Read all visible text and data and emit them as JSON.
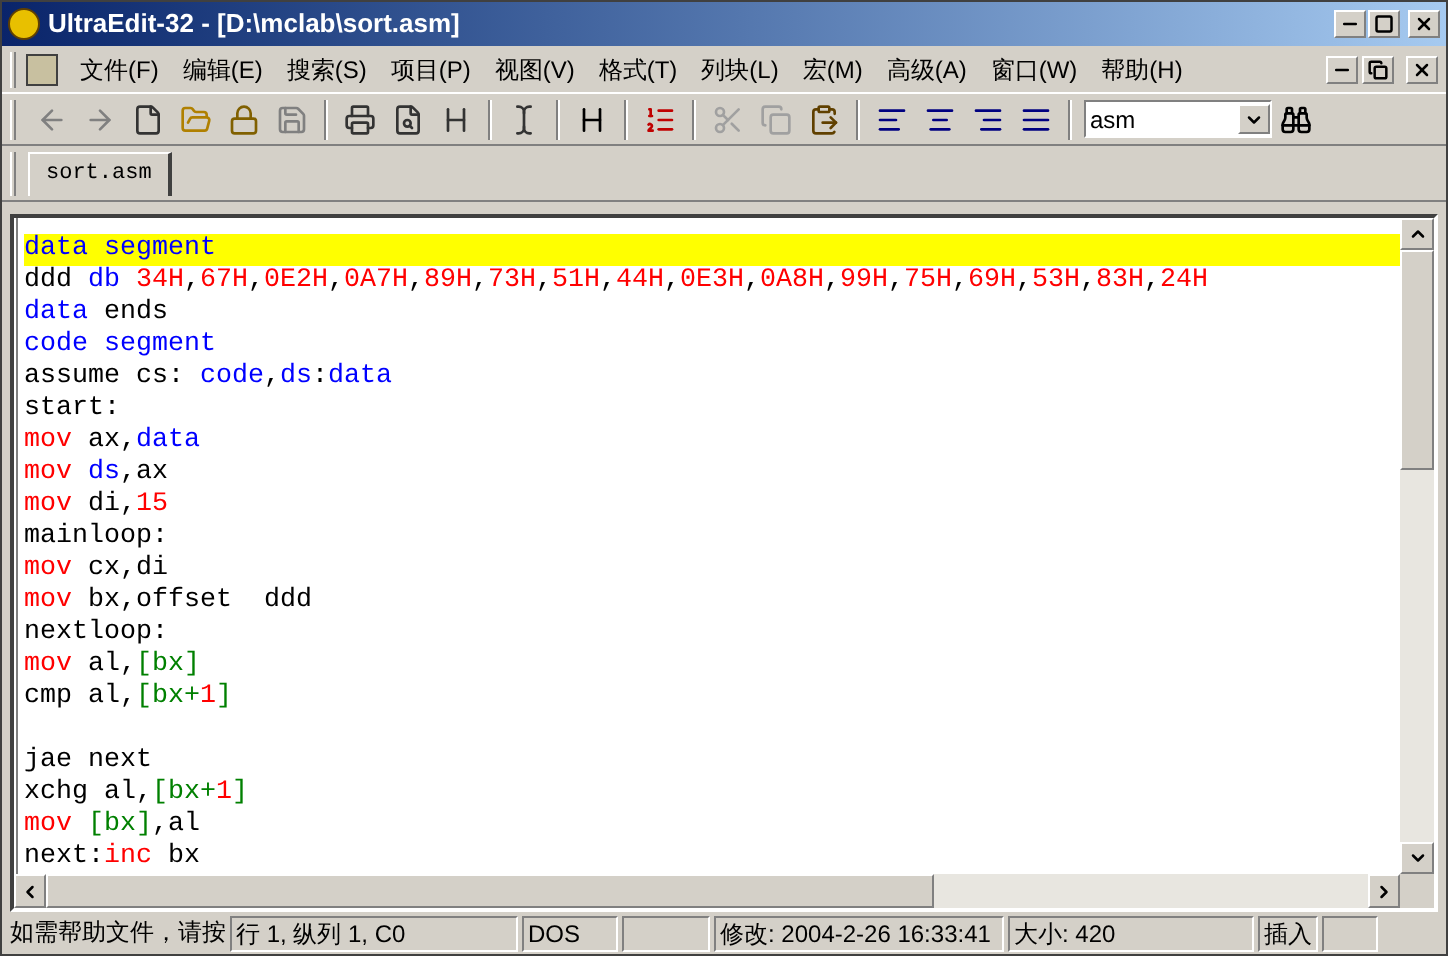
{
  "window": {
    "title": "UltraEdit-32 - [D:\\mclab\\sort.asm]"
  },
  "menu": [
    "文件(F)",
    "编辑(E)",
    "搜索(S)",
    "项目(P)",
    "视图(V)",
    "格式(T)",
    "列块(L)",
    "宏(M)",
    "高级(A)",
    "窗口(W)",
    "帮助(H)"
  ],
  "toolbar": {
    "syntax_select": {
      "value": "asm"
    }
  },
  "tabs": [
    {
      "label": "sort.asm",
      "selected": true
    }
  ],
  "editor": {
    "lines": [
      {
        "highlighted": true,
        "tokens": [
          {
            "kind": "keyword",
            "text": "data segment"
          }
        ]
      },
      {
        "highlighted": false,
        "tokens": [
          {
            "kind": "plain",
            "text": "ddd "
          },
          {
            "kind": "keyword",
            "text": "db "
          },
          {
            "kind": "number",
            "text": "34H"
          },
          {
            "kind": "plain",
            "text": ","
          },
          {
            "kind": "number",
            "text": "67H"
          },
          {
            "kind": "plain",
            "text": ","
          },
          {
            "kind": "number",
            "text": "0E2H"
          },
          {
            "kind": "plain",
            "text": ","
          },
          {
            "kind": "number",
            "text": "0A7H"
          },
          {
            "kind": "plain",
            "text": ","
          },
          {
            "kind": "number",
            "text": "89H"
          },
          {
            "kind": "plain",
            "text": ","
          },
          {
            "kind": "number",
            "text": "73H"
          },
          {
            "kind": "plain",
            "text": ","
          },
          {
            "kind": "number",
            "text": "51H"
          },
          {
            "kind": "plain",
            "text": ","
          },
          {
            "kind": "number",
            "text": "44H"
          },
          {
            "kind": "plain",
            "text": ","
          },
          {
            "kind": "number",
            "text": "0E3H"
          },
          {
            "kind": "plain",
            "text": ","
          },
          {
            "kind": "number",
            "text": "0A8H"
          },
          {
            "kind": "plain",
            "text": ","
          },
          {
            "kind": "number",
            "text": "99H"
          },
          {
            "kind": "plain",
            "text": ","
          },
          {
            "kind": "number",
            "text": "75H"
          },
          {
            "kind": "plain",
            "text": ","
          },
          {
            "kind": "number",
            "text": "69H"
          },
          {
            "kind": "plain",
            "text": ","
          },
          {
            "kind": "number",
            "text": "53H"
          },
          {
            "kind": "plain",
            "text": ","
          },
          {
            "kind": "number",
            "text": "83H"
          },
          {
            "kind": "plain",
            "text": ","
          },
          {
            "kind": "number",
            "text": "24H"
          }
        ]
      },
      {
        "highlighted": false,
        "tokens": [
          {
            "kind": "keyword",
            "text": "data"
          },
          {
            "kind": "plain",
            "text": " ends"
          }
        ]
      },
      {
        "highlighted": false,
        "tokens": [
          {
            "kind": "keyword",
            "text": "code segment"
          }
        ]
      },
      {
        "highlighted": false,
        "tokens": [
          {
            "kind": "plain",
            "text": "assume cs: "
          },
          {
            "kind": "keyword",
            "text": "code"
          },
          {
            "kind": "plain",
            "text": ","
          },
          {
            "kind": "keyword",
            "text": "ds"
          },
          {
            "kind": "plain",
            "text": ":"
          },
          {
            "kind": "keyword",
            "text": "data"
          }
        ]
      },
      {
        "highlighted": false,
        "tokens": [
          {
            "kind": "plain",
            "text": "start:"
          }
        ]
      },
      {
        "highlighted": false,
        "tokens": [
          {
            "kind": "number",
            "text": "mov"
          },
          {
            "kind": "plain",
            "text": " ax,"
          },
          {
            "kind": "keyword",
            "text": "data"
          }
        ]
      },
      {
        "highlighted": false,
        "tokens": [
          {
            "kind": "number",
            "text": "mov "
          },
          {
            "kind": "keyword",
            "text": "ds"
          },
          {
            "kind": "plain",
            "text": ",ax"
          }
        ]
      },
      {
        "highlighted": false,
        "tokens": [
          {
            "kind": "number",
            "text": "mov"
          },
          {
            "kind": "plain",
            "text": " di,"
          },
          {
            "kind": "number",
            "text": "15"
          }
        ]
      },
      {
        "highlighted": false,
        "tokens": [
          {
            "kind": "plain",
            "text": "mainloop:"
          }
        ]
      },
      {
        "highlighted": false,
        "tokens": [
          {
            "kind": "number",
            "text": "mov"
          },
          {
            "kind": "plain",
            "text": " cx,di"
          }
        ]
      },
      {
        "highlighted": false,
        "tokens": [
          {
            "kind": "number",
            "text": "mov"
          },
          {
            "kind": "plain",
            "text": " bx,offset  ddd"
          }
        ]
      },
      {
        "highlighted": false,
        "tokens": [
          {
            "kind": "plain",
            "text": "nextloop:"
          }
        ]
      },
      {
        "highlighted": false,
        "tokens": [
          {
            "kind": "number",
            "text": "mov"
          },
          {
            "kind": "plain",
            "text": " al,"
          },
          {
            "kind": "bracket",
            "text": "[bx]"
          }
        ]
      },
      {
        "highlighted": false,
        "tokens": [
          {
            "kind": "plain",
            "text": "cmp al,"
          },
          {
            "kind": "bracket",
            "text": "[bx+"
          },
          {
            "kind": "number",
            "text": "1"
          },
          {
            "kind": "bracket",
            "text": "]"
          }
        ]
      },
      {
        "highlighted": false
      },
      {
        "highlighted": false,
        "tokens": [
          {
            "kind": "plain",
            "text": "jae next"
          }
        ]
      },
      {
        "highlighted": false,
        "tokens": [
          {
            "kind": "plain",
            "text": "xchg al,"
          },
          {
            "kind": "bracket",
            "text": "[bx+"
          },
          {
            "kind": "number",
            "text": "1"
          },
          {
            "kind": "bracket",
            "text": "]"
          }
        ]
      },
      {
        "highlighted": false,
        "tokens": [
          {
            "kind": "number",
            "text": "mov "
          },
          {
            "kind": "bracket",
            "text": "[bx]"
          },
          {
            "kind": "plain",
            "text": ",al"
          }
        ]
      },
      {
        "highlighted": false,
        "tokens": [
          {
            "kind": "plain",
            "text": "next:"
          },
          {
            "kind": "number",
            "text": "inc"
          },
          {
            "kind": "plain",
            "text": " bx"
          }
        ]
      }
    ]
  },
  "status_bar": [
    "如需帮助文件，请按",
    "行 1, 纵列 1, C0",
    "DOS",
    "修改: 2004-2-26 16:33:41",
    "大小: 420",
    "插入"
  ]
}
